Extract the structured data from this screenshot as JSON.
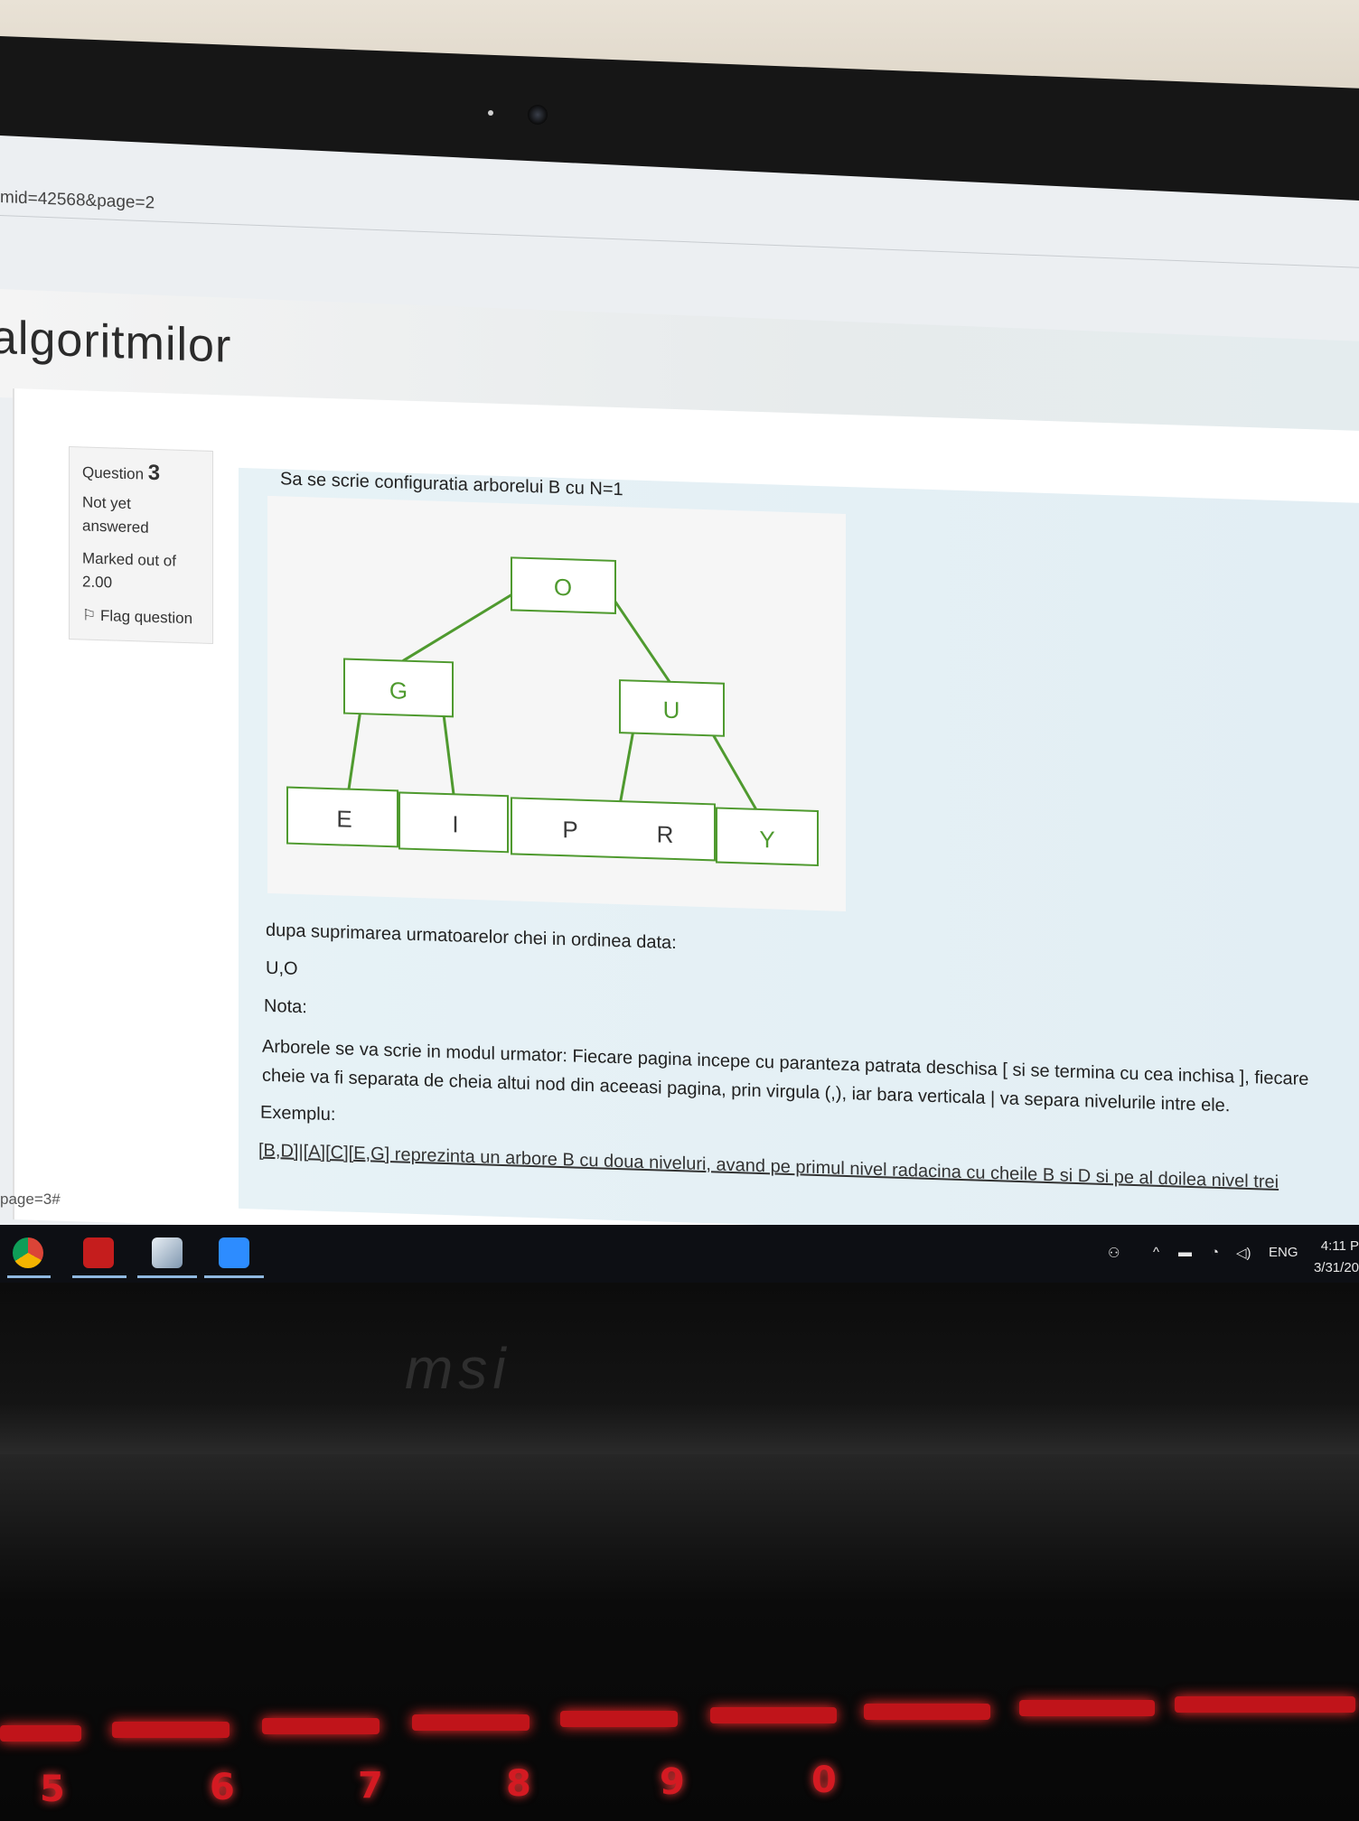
{
  "browser": {
    "url_fragment": "mid=42568&page=2"
  },
  "site": {
    "course_title": "algoritmilor"
  },
  "question_info": {
    "label": "Question",
    "number": "3",
    "status": "Not yet answered",
    "marked": "Marked out of 2.00",
    "flag": "Flag question"
  },
  "question": {
    "prompt": "Sa se scrie configuratia arborelui B cu N=1",
    "after_diagram": "dupa suprimarea urmatoarelor chei in ordinea data:",
    "keys": "U,O",
    "nota_label": "Nota:",
    "nota_text": "Arborele se va scrie in modul urmator: Fiecare pagina incepe cu paranteza patrata deschisa [ si se termina cu cea inchisa ], fiecare cheie va fi separata de cheia altui nod din aceeasi pagina, prin virgula (,), iar bara verticala | va separa nivelurile intre ele.",
    "exemplu_label": "Exemplu:",
    "exemplu_text": "[B,D]|[A][C][E,G] reprezinta un arbore B cu doua niveluri, avand pe primul nivel radacina cu cheile B si D si pe al doilea nivel trei"
  },
  "tree": {
    "root": "O",
    "level1": [
      "G",
      "U"
    ],
    "leaves": [
      "E",
      "I",
      "P",
      "R",
      "Y"
    ]
  },
  "status_bar": {
    "link": "page=3#"
  },
  "taskbar": {
    "lang": "ENG",
    "time": "4:11 P",
    "date": "3/31/20"
  },
  "laptop": {
    "brand": "msi"
  },
  "keyboard": {
    "keys": [
      "5",
      "6",
      "7",
      "8",
      "9",
      "0"
    ]
  }
}
